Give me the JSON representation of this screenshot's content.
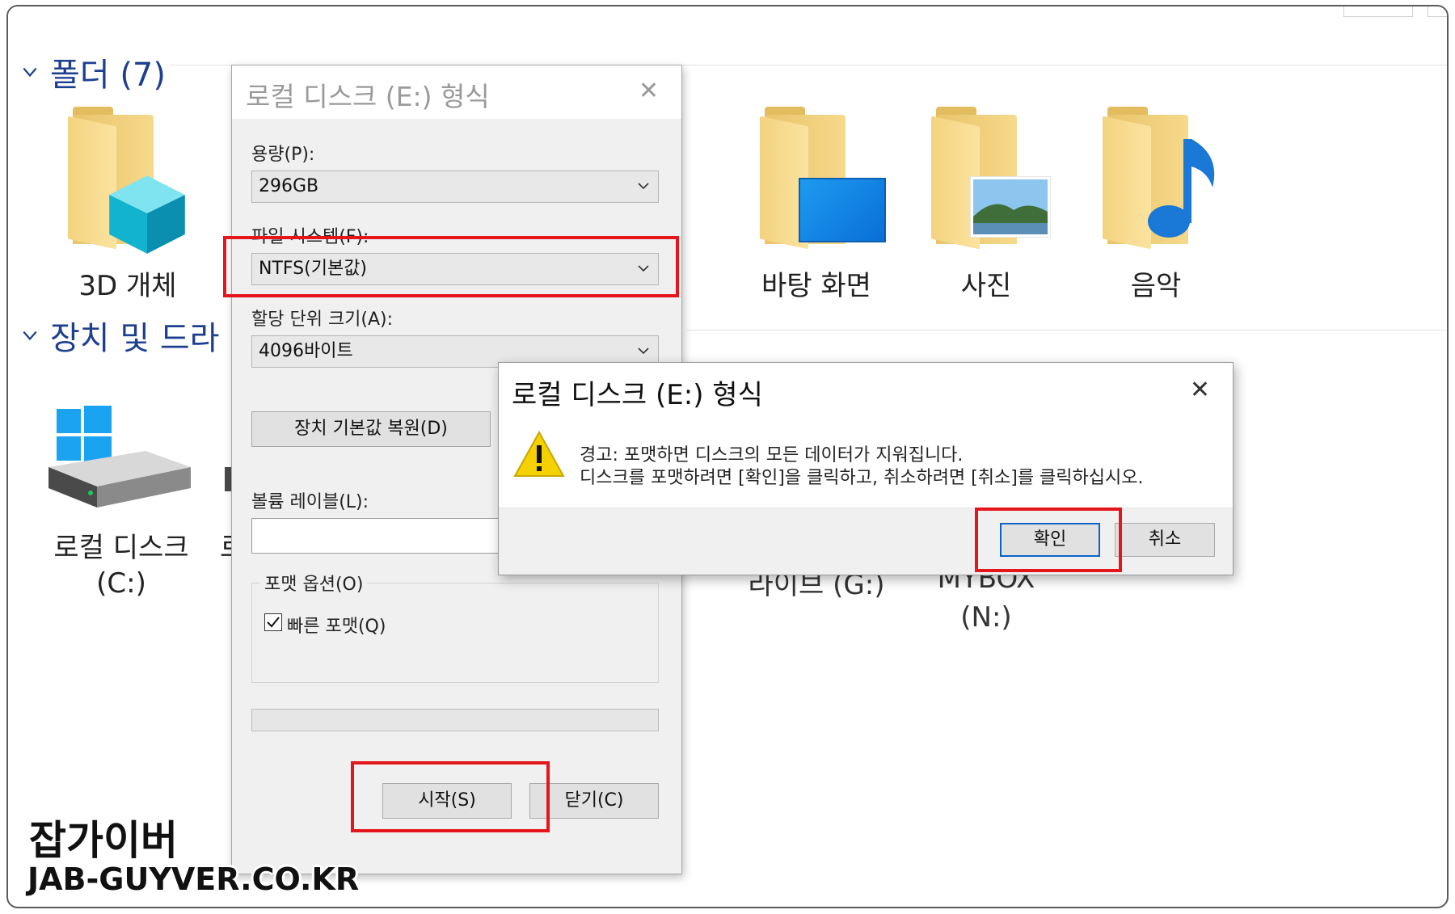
{
  "explorer": {
    "folders_section": {
      "title": "폴더 (7)"
    },
    "devices_section": {
      "title": "장치 및 드라"
    },
    "folders": [
      {
        "label": "3D 개체"
      },
      {
        "label": "바탕 화면"
      },
      {
        "label": "사진"
      },
      {
        "label": "음악"
      }
    ],
    "drives": [
      {
        "label": "로컬 디스크",
        "letter": "(C:)"
      },
      {
        "label_partial": "로"
      },
      {
        "label": "라이브 (G:)"
      },
      {
        "label": "MYBOX",
        "letter": "(N:)"
      }
    ]
  },
  "format_dialog": {
    "title": "로컬 디스크 (E:) 형식",
    "capacity_label": "용량(P):",
    "capacity_value": "296GB",
    "filesystem_label": "파일 시스템(F):",
    "filesystem_value": "NTFS(기본값)",
    "allocation_label": "할당 단위 크기(A):",
    "allocation_value": "4096바이트",
    "restore_defaults_button": "장치 기본값 복원(D)",
    "volume_label_label": "볼륨 레이블(L):",
    "volume_label_value": "",
    "format_options_title": "포맷 옵션(O)",
    "quick_format_label": "빠른 포맷(Q)",
    "quick_format_checked": true,
    "progress": 0,
    "start_button": "시작(S)",
    "close_button": "닫기(C)"
  },
  "warning_dialog": {
    "title": "로컬 디스크 (E:) 형식",
    "message_line1": "경고: 포맷하면 디스크의 모든 데이터가 지워집니다.",
    "message_line2": "디스크를 포맷하려면 [확인]을 클릭하고, 취소하려면 [취소]를 클릭하십시오.",
    "ok_button": "확인",
    "cancel_button": "취소"
  },
  "watermark": {
    "line1": "잡가이버",
    "line2": "JAB-GUYVER.CO.KR"
  },
  "colors": {
    "highlight_red": "#e5161b",
    "section_blue": "#1e3f8f",
    "warning_yellow": "#f5d100",
    "primary_button_border": "#0a64c8"
  }
}
